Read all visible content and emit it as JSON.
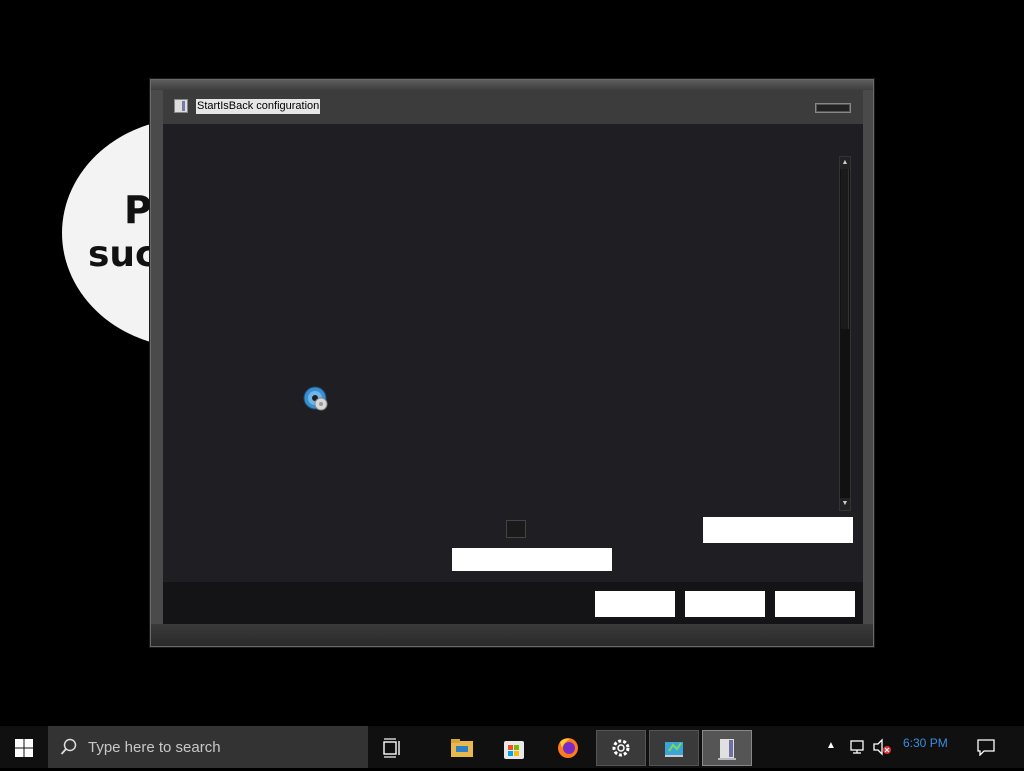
{
  "background": {
    "oval_text_line1": "Po",
    "oval_text_line2": "such"
  },
  "window": {
    "title": "StartIsBack configuration",
    "icon": "startisback-app-icon",
    "minimize_icon": "minimize-icon",
    "scroll_up_glyph": "▲",
    "scroll_down_glyph": "▼",
    "content_icon": "disc-icon",
    "buttons": [
      "",
      "",
      ""
    ]
  },
  "taskbar": {
    "search_placeholder": "Type here to search",
    "clock_time": "6:30 PM",
    "tray_chevron": "▲",
    "pinned": [
      "task-view-icon",
      "file-explorer-icon",
      "microsoft-store-icon",
      "firefox-icon",
      "settings-icon",
      "app-icon",
      "startisback-icon"
    ]
  },
  "colors": {
    "accent_clock": "#3a8de0",
    "client_bg": "#1f1e23",
    "frame": "#4a4a4a"
  }
}
